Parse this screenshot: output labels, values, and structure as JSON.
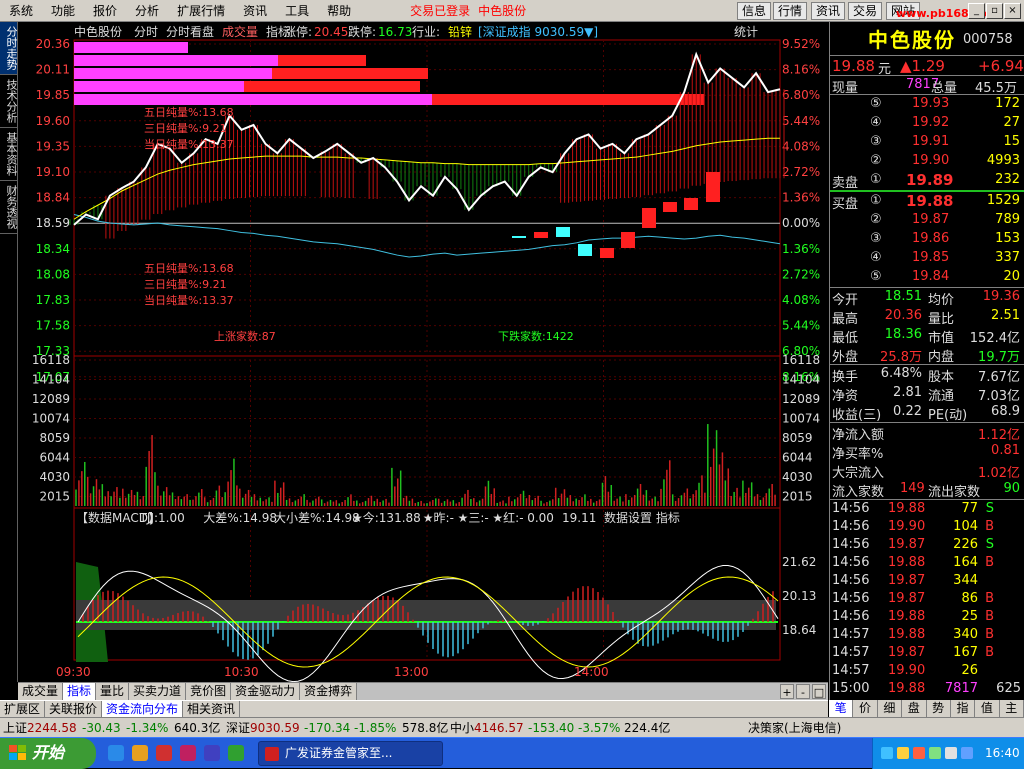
{
  "menubar": {
    "items": [
      "系统",
      "功能",
      "报价",
      "分析",
      "扩展行情",
      "资讯",
      "工具",
      "帮助"
    ],
    "center": [
      "交易已登录",
      "中色股份"
    ],
    "right_buttons": [
      "信息",
      "行情",
      "资讯",
      "交易",
      "网站"
    ],
    "watermark": "www.pb168.com"
  },
  "side_tabs": [
    "分时走势",
    "技术分析",
    "基本资料",
    "财务透视"
  ],
  "chart_header": {
    "name": "中色股份",
    "items": [
      "分时",
      "分时看盘",
      "成交量",
      "指标"
    ],
    "zt_label": "涨停:",
    "zt_val": "20.45",
    "dt_label": "跌停:",
    "dt_val": "16.73",
    "ind_label": "行业:",
    "ind_val": "铅锌",
    "index_label": "[深证成指 9030.59▼]",
    "stat": "统计"
  },
  "chart_data": {
    "type": "line",
    "title": "中色股份",
    "price_axis": [
      "20.36",
      "20.11",
      "19.85",
      "19.60",
      "19.35",
      "19.10",
      "18.84",
      "18.59",
      "18.34",
      "18.08",
      "17.83",
      "17.58",
      "17.33",
      "17.07"
    ],
    "pct_axis": [
      "9.52%",
      "8.16%",
      "6.80%",
      "5.44%",
      "4.08%",
      "2.72%",
      "1.36%",
      "0.00%",
      "1.36%",
      "2.72%",
      "4.08%",
      "5.44%",
      "6.80%",
      "8.16%"
    ],
    "prev_close": 18.59,
    "price_min": 17.07,
    "price_max": 20.36,
    "volume_axis": [
      "16118",
      "14104",
      "12089",
      "10074",
      "8059",
      "6044",
      "4030",
      "2015"
    ],
    "volume_max": 16118,
    "time_labels": [
      "09:30",
      "10:30",
      "13:00",
      "14:00"
    ],
    "price_series": [
      18.44,
      18.55,
      18.5,
      18.75,
      18.83,
      18.9,
      19.05,
      19.3,
      19.25,
      19.1,
      19.2,
      19.35,
      19.3,
      19.6,
      19.45,
      19.5,
      19.3,
      19.2,
      19.35,
      19.25,
      19.15,
      19.22,
      19.3,
      19.2,
      19.1,
      19.15,
      19.05,
      18.9,
      18.7,
      18.85,
      18.75,
      18.95,
      18.82,
      18.6,
      18.75,
      18.85,
      18.9,
      18.75,
      18.95,
      19.05,
      19.0,
      19.2,
      19.35,
      19.4,
      19.25,
      19.3,
      19.2,
      19.35,
      19.4,
      19.5,
      19.6,
      19.85,
      20.25,
      19.95,
      20.1,
      20.0,
      19.9,
      20.05,
      19.85,
      19.88
    ],
    "avg_series": [
      18.5,
      18.58,
      18.65,
      18.72,
      18.8,
      18.86,
      18.92,
      18.98,
      19.02,
      19.05,
      19.08,
      19.1,
      19.12,
      19.14,
      19.15,
      19.16,
      19.17,
      19.17,
      19.17,
      19.17,
      19.16,
      19.16,
      19.16,
      19.15,
      19.15,
      19.14,
      19.13,
      19.12,
      19.11,
      19.1,
      19.1,
      19.09,
      19.09,
      19.08,
      19.08,
      19.08,
      19.08,
      19.08,
      19.08,
      19.09,
      19.09,
      19.1,
      19.11,
      19.12,
      19.13,
      19.14,
      19.15,
      19.16,
      19.18,
      19.2,
      19.22,
      19.25,
      19.28,
      19.3,
      19.32,
      19.33,
      19.34,
      19.35,
      19.36,
      19.36
    ],
    "index_series": [
      18.55,
      18.52,
      18.48,
      18.46,
      18.45,
      18.44,
      18.45,
      18.46,
      18.44,
      18.43,
      18.42,
      18.41,
      18.4,
      18.38,
      18.36,
      18.35,
      18.33,
      18.32,
      18.3,
      18.28,
      18.26,
      18.25,
      18.24,
      18.22,
      18.2,
      18.18,
      18.15,
      18.12,
      18.1,
      18.11,
      18.13,
      18.14,
      18.12,
      18.13,
      18.14,
      18.15,
      18.16,
      18.17,
      18.18,
      18.2,
      18.22,
      18.23,
      18.25,
      18.28,
      18.29,
      18.3,
      18.3,
      18.31,
      18.32,
      18.31,
      18.3,
      18.29,
      18.3,
      18.32,
      18.33,
      18.31,
      18.3,
      18.28,
      18.26,
      18.24
    ],
    "volume_series": [
      5200,
      4000,
      3000,
      2600,
      2200,
      1800,
      9000,
      2400,
      1600,
      1400,
      2000,
      1200,
      2800,
      6500,
      2200,
      1500,
      1100,
      3000,
      900,
      1400,
      1100,
      900,
      800,
      1600,
      700,
      1300,
      900,
      4500,
      1200,
      600,
      900,
      1000,
      800,
      2200,
      1000,
      3200,
      700,
      1100,
      1800,
      1200,
      800,
      2500,
      1500,
      1600,
      900,
      3800,
      1200,
      1400,
      2600,
      1100,
      5400,
      1600,
      2400,
      4200,
      10400,
      6800,
      2300,
      3000,
      1400,
      2600
    ],
    "annotations": {
      "top": [
        "五日纯量%:13.68",
        "三日纯量%:9.21",
        "当日纯量%:13.37"
      ],
      "mid": [
        "五日纯量%:13.68",
        "三日纯量%:9.21",
        "当日纯量%:13.37"
      ],
      "up_count": "上涨家数:87",
      "down_count": "下跌家数:1422"
    },
    "macd": {
      "header": [
        "【数据MACD】",
        "TJJ:1.00",
        "大差%:14.98",
        "大小差%:14.98",
        "★今:131.88",
        "★昨:-",
        "★三:-",
        "★红:-",
        "0.00",
        "19.11",
        "数据设置 指标"
      ],
      "axis": [
        "21.62",
        "20.13",
        "18.64"
      ]
    }
  },
  "quote": {
    "name": "中色股份",
    "code": "000758",
    "price": "19.88",
    "price_unit": "元",
    "change": "▲1.29",
    "change_pct": "+6.94",
    "xl_label": "现量",
    "xl_val": "7817",
    "zl_label": "总量",
    "zl_val": "45.5万",
    "sell": [
      {
        "lv": "⑤",
        "p": "19.93",
        "v": "172"
      },
      {
        "lv": "④",
        "p": "19.92",
        "v": "27"
      },
      {
        "lv": "③",
        "p": "19.91",
        "v": "15"
      },
      {
        "lv": "②",
        "p": "19.90",
        "v": "4993"
      },
      {
        "lv": "①",
        "p": "19.89",
        "v": "232"
      }
    ],
    "sell_label": "卖盘",
    "buy_label": "买盘",
    "buy": [
      {
        "lv": "①",
        "p": "19.88",
        "v": "1529"
      },
      {
        "lv": "②",
        "p": "19.87",
        "v": "789"
      },
      {
        "lv": "③",
        "p": "19.86",
        "v": "153"
      },
      {
        "lv": "④",
        "p": "19.85",
        "v": "337"
      },
      {
        "lv": "⑤",
        "p": "19.84",
        "v": "20"
      }
    ],
    "stats1": [
      [
        "今开",
        "18.51",
        "均价",
        "19.36"
      ],
      [
        "最高",
        "20.36",
        "量比",
        "2.51"
      ],
      [
        "最低",
        "18.36",
        "市值",
        "152.4亿"
      ],
      [
        "外盘",
        "25.8万",
        "内盘",
        "19.7万"
      ]
    ],
    "stats2": [
      [
        "换手",
        "6.48%",
        "股本",
        "7.67亿"
      ],
      [
        "净资",
        "2.81",
        "流通",
        "7.03亿"
      ],
      [
        "收益(三)",
        "0.22",
        "PE(动)",
        "68.9"
      ]
    ],
    "flow": [
      [
        "净流入额",
        "1.12亿"
      ],
      [
        "净买率%",
        "0.81"
      ],
      [
        "大宗流入",
        "1.02亿"
      ]
    ],
    "flow_count": [
      "流入家数",
      "149",
      "流出家数",
      "90"
    ],
    "ticks": [
      [
        "14:56",
        "19.88",
        "77",
        "S"
      ],
      [
        "14:56",
        "19.90",
        "104",
        "B"
      ],
      [
        "14:56",
        "19.87",
        "226",
        "S"
      ],
      [
        "14:56",
        "19.88",
        "164",
        "B"
      ],
      [
        "14:56",
        "19.87",
        "344",
        ""
      ],
      [
        "14:56",
        "19.87",
        "86",
        "B"
      ],
      [
        "14:56",
        "19.88",
        "25",
        "B"
      ],
      [
        "14:57",
        "19.88",
        "340",
        "B"
      ],
      [
        "14:57",
        "19.87",
        "167",
        "B"
      ],
      [
        "14:57",
        "19.90",
        "26",
        ""
      ],
      [
        "15:00",
        "19.88",
        "7817",
        "625"
      ]
    ]
  },
  "bottom_tabs": [
    "成交量",
    "指标",
    "量比",
    "买卖力道",
    "竞价图",
    "资金驱动力",
    "资金搏弈"
  ],
  "bottom_tabs2": [
    "扩展区",
    "关联报价",
    "资金流向分布",
    "相关资讯"
  ],
  "rp_tabs": [
    "笔",
    "价",
    "细",
    "盘",
    "势",
    "指",
    "值",
    "主"
  ],
  "ticker": {
    "sh_label": "上证",
    "sh_val": "2244.58",
    "sh_chg": "-30.43",
    "sh_pct": "-1.34%",
    "sh_amt": "640.3亿",
    "sz_label": "深证",
    "sz_val": "9030.59",
    "sz_chg": "-170.34",
    "sz_pct": "-1.85%",
    "sz_amt": "578.8亿",
    "zx_label": "中小",
    "zx_val": "4146.57",
    "zx_chg": "-153.40",
    "zx_pct": "-3.57%",
    "zx_amt": "224.4亿",
    "right": "决策家(上海电信)"
  },
  "taskbar": {
    "start": "开始",
    "task": "广发证券金管家至...",
    "time": "16:40"
  }
}
